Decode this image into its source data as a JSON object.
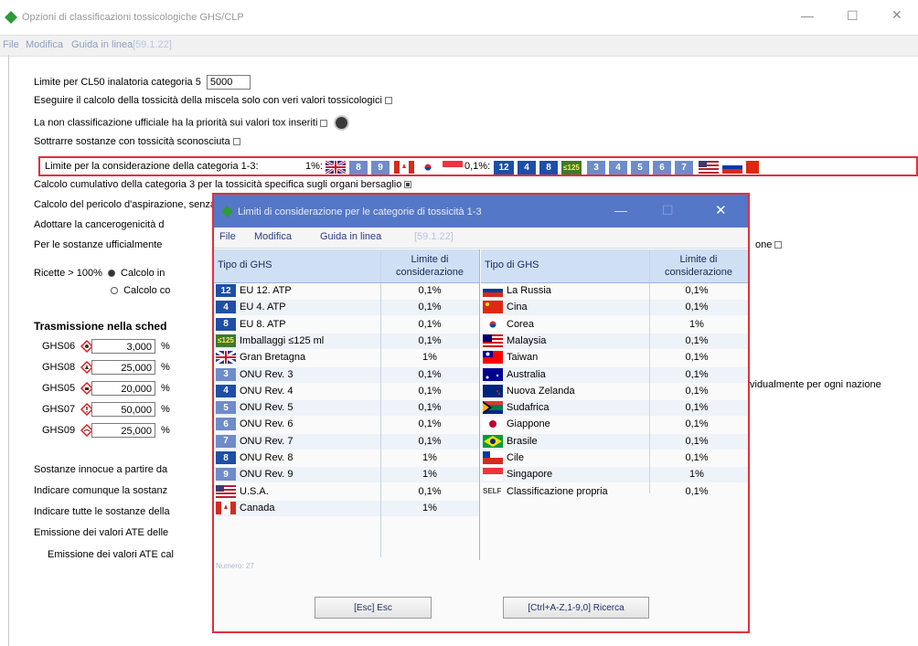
{
  "main": {
    "title": "Opzioni di classificazioni tossicologiche GHS/CLP",
    "menu": {
      "file": "File",
      "edit": "Modifica",
      "help": "Guida in linea",
      "version": "[59.1.22]"
    },
    "cl50_label": "Limite per CL50 inalatoria categoria 5",
    "cl50_value": "5000",
    "opt_tox_only": "Eseguire il calcolo della tossicità della miscela solo con veri valori tossicologici",
    "opt_nonclass": "La non classificazione ufficiale ha la priorità sui valori tox inseriti",
    "opt_subtract": "Sottrarre sostanze con tossicità sconosciuta",
    "limit_label": "Limite per la considerazione della categoria 1-3:",
    "limit_1pct": "1%:",
    "limit_01pct": "0,1%:",
    "chips_01": [
      "12",
      "4",
      "8",
      "≤125"
    ],
    "chips_light": [
      "3",
      "4",
      "5",
      "6",
      "7"
    ],
    "opt_cumulative": "Calcolo cumulativo della categoria 3 per la tossicità specifica sugli organi bersaglio",
    "opt_aspiration": "Calcolo del pericolo d'aspirazione, senza considerare la viscosità",
    "opt_carcino": "Adottare la cancerogenicità d",
    "opt_official": "Per le sostanze ufficialmente",
    "opt_official_tail": "one",
    "recipes_label": "Ricette > 100%",
    "recipes_opt1": "Calcolo in",
    "recipes_opt2": "Calcolo co",
    "transmission_heading": "Trasmissione nella sched",
    "ghs_rows": [
      {
        "code": "GHS06",
        "value": "3,000"
      },
      {
        "code": "GHS08",
        "value": "25,000"
      },
      {
        "code": "GHS05",
        "value": "20,000"
      },
      {
        "code": "GHS07",
        "value": "50,000"
      },
      {
        "code": "GHS09",
        "value": "25,000"
      }
    ],
    "pct_unit": "%",
    "right_tail": "vidualmente per ogni nazione",
    "lower_rows": [
      "Sostanze innocue a partire da",
      "Indicare comunque la sostanz",
      "Indicare tutte le sostanze della",
      "Emissione dei valori ATE delle",
      "Emissione dei valori ATE cal"
    ]
  },
  "dialog": {
    "title": "Limiti di considerazione per le categorie di tossicità 1-3",
    "menu": {
      "file": "File",
      "edit": "Modifica",
      "help": "Guida in linea",
      "version": "[59.1.22]"
    },
    "col_type": "Tipo di GHS",
    "col_limit": "Limite di considerazione",
    "left_rows": [
      {
        "badge": "12",
        "label": "EU 12. ATP",
        "limit": "0,1%"
      },
      {
        "badge": "4",
        "label": "EU 4. ATP",
        "limit": "0,1%"
      },
      {
        "badge": "8",
        "label": "EU 8. ATP",
        "limit": "0,1%"
      },
      {
        "badge": "≤125",
        "label": "Imballaggi ≤125 ml",
        "limit": "0,1%"
      },
      {
        "badge": "GB",
        "label": "Gran Bretagna",
        "limit": "1%"
      },
      {
        "badge": "3",
        "label": "ONU Rev. 3",
        "limit": "0,1%"
      },
      {
        "badge": "4",
        "label": "ONU Rev. 4",
        "limit": "0,1%"
      },
      {
        "badge": "5",
        "label": "ONU Rev. 5",
        "limit": "0,1%"
      },
      {
        "badge": "6",
        "label": "ONU Rev. 6",
        "limit": "0,1%"
      },
      {
        "badge": "7",
        "label": "ONU Rev. 7",
        "limit": "0,1%"
      },
      {
        "badge": "8",
        "label": "ONU Rev. 8",
        "limit": "1%"
      },
      {
        "badge": "9",
        "label": "ONU Rev. 9",
        "limit": "1%"
      },
      {
        "badge": "US",
        "label": "U.S.A.",
        "limit": "0,1%"
      },
      {
        "badge": "CA",
        "label": "Canada",
        "limit": "1%"
      }
    ],
    "right_rows": [
      {
        "badge": "RU",
        "label": "La Russia",
        "limit": "0,1%"
      },
      {
        "badge": "CN",
        "label": "Cina",
        "limit": "0,1%"
      },
      {
        "badge": "KR",
        "label": "Corea",
        "limit": "1%"
      },
      {
        "badge": "MY",
        "label": "Malaysia",
        "limit": "0,1%"
      },
      {
        "badge": "TW",
        "label": "Taiwan",
        "limit": "0,1%"
      },
      {
        "badge": "AU",
        "label": "Australia",
        "limit": "0,1%"
      },
      {
        "badge": "NZ",
        "label": "Nuova Zelanda",
        "limit": "0,1%"
      },
      {
        "badge": "ZA",
        "label": "Sudafrica",
        "limit": "0,1%"
      },
      {
        "badge": "JP",
        "label": "Giappone",
        "limit": "0,1%"
      },
      {
        "badge": "BR",
        "label": "Brasile",
        "limit": "0,1%"
      },
      {
        "badge": "CL",
        "label": "Cile",
        "limit": "0,1%"
      },
      {
        "badge": "SG",
        "label": "Singapore",
        "limit": "1%"
      },
      {
        "badge": "SELF",
        "label": "Classificazione propria",
        "limit": "0,1%"
      }
    ],
    "count_text": "Numero: 27",
    "btn_esc": "[Esc] Esc",
    "btn_search": "[Ctrl+A-Z,1-9,0] Ricerca"
  }
}
